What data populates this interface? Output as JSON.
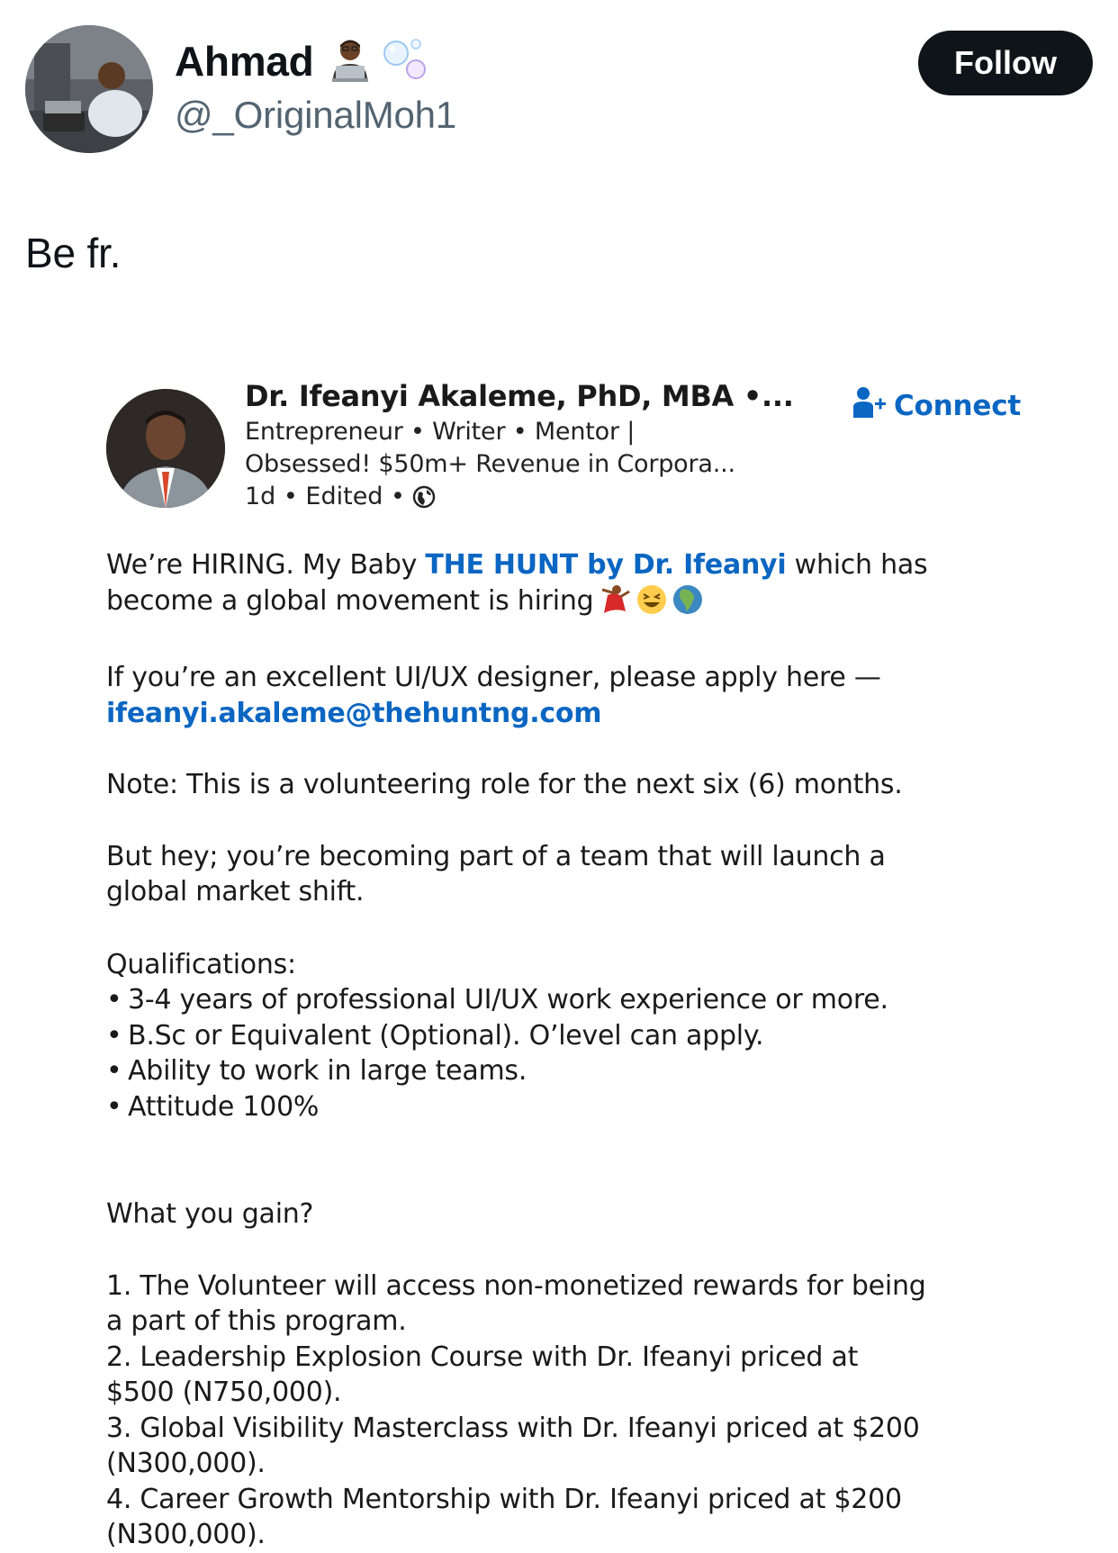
{
  "tweet": {
    "author": {
      "display_name": "Ahmad",
      "handle": "@_OriginalMoh1",
      "name_emojis": [
        "technologist-icon",
        "bubbles-icon"
      ]
    },
    "follow_label": "Follow",
    "text": "Be fr."
  },
  "linkedin_post": {
    "author_name": "Dr. Ifeanyi Akaleme, PhD, MBA •...",
    "headline_line1": "Entrepreneur • Writer • Mentor |",
    "headline_line2": "Obsessed! $50m+ Revenue in Corpora...",
    "meta": "1d • Edited •",
    "connect_label": "Connect",
    "intro_a": "We’re HIRING. My Baby ",
    "intro_link": "THE HUNT by Dr. Ifeanyi",
    "intro_b": " which has",
    "intro_line2": "become a global movement is hiring",
    "apply_line": "If you’re an excellent UI/UX designer, please apply here —",
    "email": "ifeanyi.akaleme@thehuntng.com",
    "note": "Note: This is a volunteering role for the next six (6) months.",
    "but_hey_1": "But hey; you’re becoming part of a team that will launch a",
    "but_hey_2": "global market shift.",
    "qualifications_title": "Qualifications:",
    "qualifications": [
      "3-4 years of professional UI/UX work experience or more.",
      "B.Sc or Equivalent (Optional). O’level can apply.",
      "Ability to work in large teams.",
      "Attitude 100%"
    ],
    "gain_title": "What you gain?",
    "gains": [
      {
        "line1": "1. The Volunteer will access non-monetized rewards for being",
        "line2": "a part of this program."
      },
      {
        "line1": "2. Leadership Explosion Course with Dr. Ifeanyi priced at",
        "line2": "$500 (N750,000)."
      },
      {
        "line1": "3. Global Visibility Masterclass with Dr. Ifeanyi priced at $200",
        "line2": "(N300,000)."
      },
      {
        "line1": "4. Career Growth Mentorship with Dr. Ifeanyi priced at $200",
        "line2": "(N300,000)."
      }
    ],
    "hiring_emojis": [
      "dancer-icon",
      "laughing-face-icon",
      "globe-africa-icon"
    ]
  },
  "colors": {
    "link_blue": "#0a66c2",
    "follow_bg": "#0f1419",
    "handle_gray": "#536471"
  }
}
